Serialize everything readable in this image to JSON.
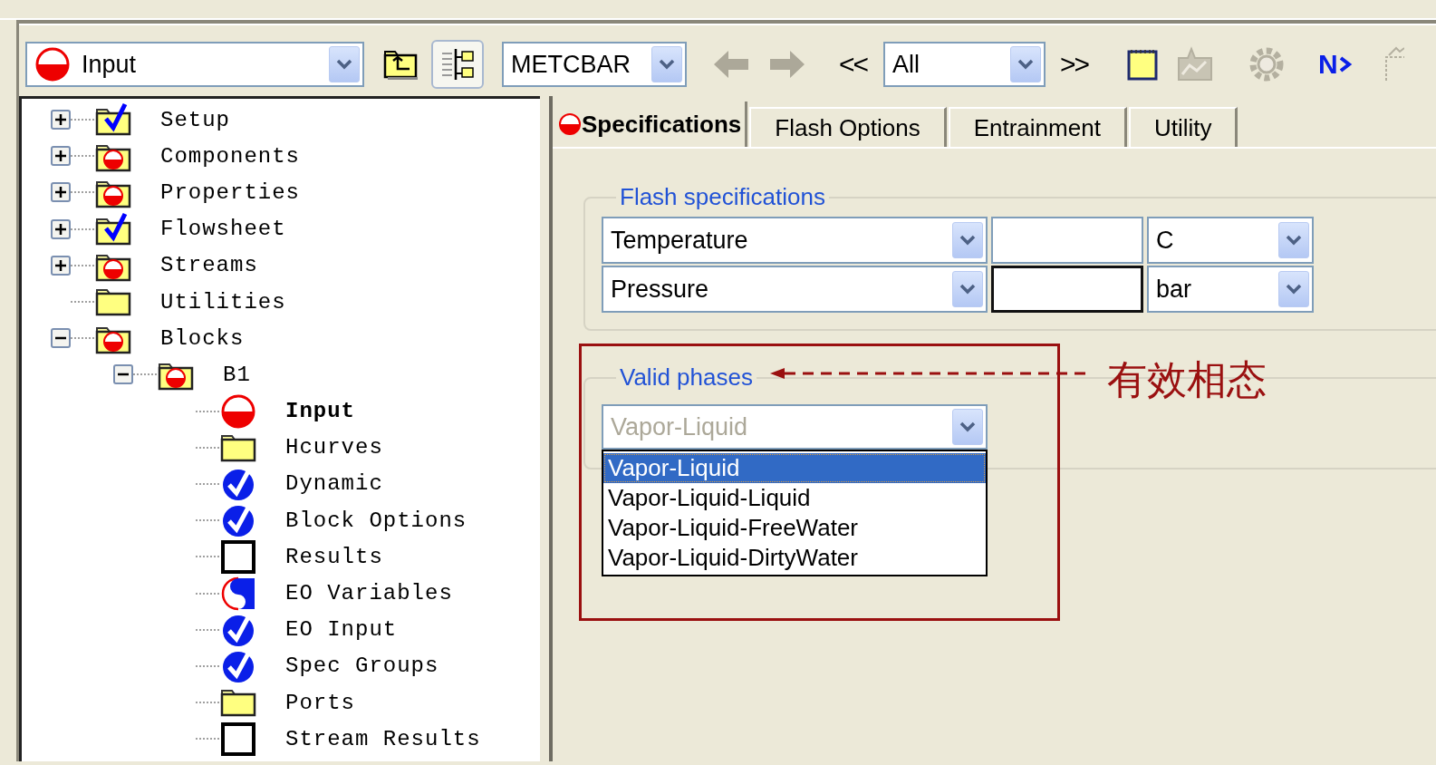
{
  "toolbar": {
    "form_combo": {
      "value": "Input"
    },
    "units_combo": {
      "value": "METCBAR"
    },
    "back_button": {
      "disabled": true
    },
    "forward_button": {
      "disabled": true
    },
    "prev_button": {
      "label": "<<"
    },
    "filter_combo": {
      "value": "All"
    },
    "next_button": {
      "label": ">>"
    },
    "tool_buttons": [
      {
        "kind": "notes",
        "disabled": false
      },
      {
        "kind": "chart",
        "disabled": true
      },
      {
        "kind": "gear",
        "disabled": true
      },
      {
        "kind": "next-input",
        "label": "N",
        "disabled": false
      },
      {
        "kind": "partial",
        "disabled": true
      }
    ]
  },
  "tree": {
    "items": [
      {
        "label": "Setup",
        "kind": "folder-check",
        "expanded": false,
        "selected": false
      },
      {
        "label": "Components",
        "kind": "folder-red",
        "expanded": false,
        "selected": false
      },
      {
        "label": "Properties",
        "kind": "folder-red",
        "expanded": false,
        "selected": false
      },
      {
        "label": "Flowsheet",
        "kind": "folder-check",
        "expanded": false,
        "selected": false
      },
      {
        "label": "Streams",
        "kind": "folder-red",
        "expanded": false,
        "selected": false
      },
      {
        "label": "Utilities",
        "kind": "folder",
        "selected": false
      },
      {
        "label": "Blocks",
        "kind": "folder-red",
        "expanded": true,
        "selected": false,
        "children": [
          {
            "label": "B1",
            "kind": "folder-red",
            "expanded": true,
            "selected": false,
            "children": [
              {
                "label": "Input",
                "kind": "red-half",
                "selected": true
              },
              {
                "label": "Hcurves",
                "kind": "folder",
                "selected": false
              },
              {
                "label": "Dynamic",
                "kind": "check-circle",
                "selected": false
              },
              {
                "label": "Block Options",
                "kind": "check-circle",
                "selected": false
              },
              {
                "label": "Results",
                "kind": "empty",
                "selected": false
              },
              {
                "label": "EO Variables",
                "kind": "eo",
                "selected": false
              },
              {
                "label": "EO Input",
                "kind": "check-circle",
                "selected": false
              },
              {
                "label": "Spec Groups",
                "kind": "check-circle",
                "selected": false
              },
              {
                "label": "Ports",
                "kind": "folder",
                "selected": false
              },
              {
                "label": "Stream Results",
                "kind": "empty",
                "selected": false
              }
            ]
          }
        ]
      }
    ]
  },
  "tabs": [
    {
      "label": "Specifications",
      "selected": true,
      "kind": "incomplete"
    },
    {
      "label": "Flash Options",
      "selected": false,
      "kind": "plain"
    },
    {
      "label": "Entrainment",
      "selected": false,
      "kind": "plain"
    },
    {
      "label": "Utility",
      "selected": false,
      "kind": "plain"
    }
  ],
  "flash_specifications": {
    "title": "Flash specifications",
    "rows": [
      {
        "variable": "Temperature",
        "focused": false,
        "unit": "C"
      },
      {
        "variable": "Pressure",
        "focused": true,
        "unit": "bar"
      }
    ]
  },
  "valid_phases": {
    "title": "Valid phases",
    "combo": {
      "value": "Vapor-Liquid",
      "disabled": true
    },
    "options": [
      {
        "label": "Vapor-Liquid",
        "selected": true
      },
      {
        "label": "Vapor-Liquid-Liquid",
        "selected": false
      },
      {
        "label": "Vapor-Liquid-FreeWater",
        "selected": false
      },
      {
        "label": "Vapor-Liquid-DirtyWater",
        "selected": false
      }
    ]
  },
  "annotation": {
    "label": "有效相态"
  }
}
